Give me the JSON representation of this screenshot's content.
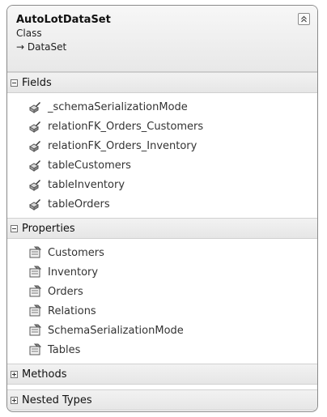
{
  "class_shape": {
    "title": "AutoLotDataSet",
    "kind": "Class",
    "base": "→ DataSet",
    "collapse_glyph": "⏫"
  },
  "sections": {
    "fields": {
      "label": "Fields",
      "expanded": true,
      "items": [
        {
          "label": "_schemaSerializationMode",
          "icon": "field-icon"
        },
        {
          "label": "relationFK_Orders_Customers",
          "icon": "field-icon"
        },
        {
          "label": "relationFK_Orders_Inventory",
          "icon": "field-icon"
        },
        {
          "label": "tableCustomers",
          "icon": "field-icon"
        },
        {
          "label": "tableInventory",
          "icon": "field-icon"
        },
        {
          "label": "tableOrders",
          "icon": "field-icon"
        }
      ]
    },
    "properties": {
      "label": "Properties",
      "expanded": true,
      "items": [
        {
          "label": "Customers",
          "icon": "property-icon"
        },
        {
          "label": "Inventory",
          "icon": "property-icon"
        },
        {
          "label": "Orders",
          "icon": "property-icon"
        },
        {
          "label": "Relations",
          "icon": "property-icon"
        },
        {
          "label": "SchemaSerializationMode",
          "icon": "property-icon"
        },
        {
          "label": "Tables",
          "icon": "property-icon"
        }
      ]
    },
    "methods": {
      "label": "Methods",
      "expanded": false
    },
    "nested_types": {
      "label": "Nested Types",
      "expanded": false
    }
  }
}
